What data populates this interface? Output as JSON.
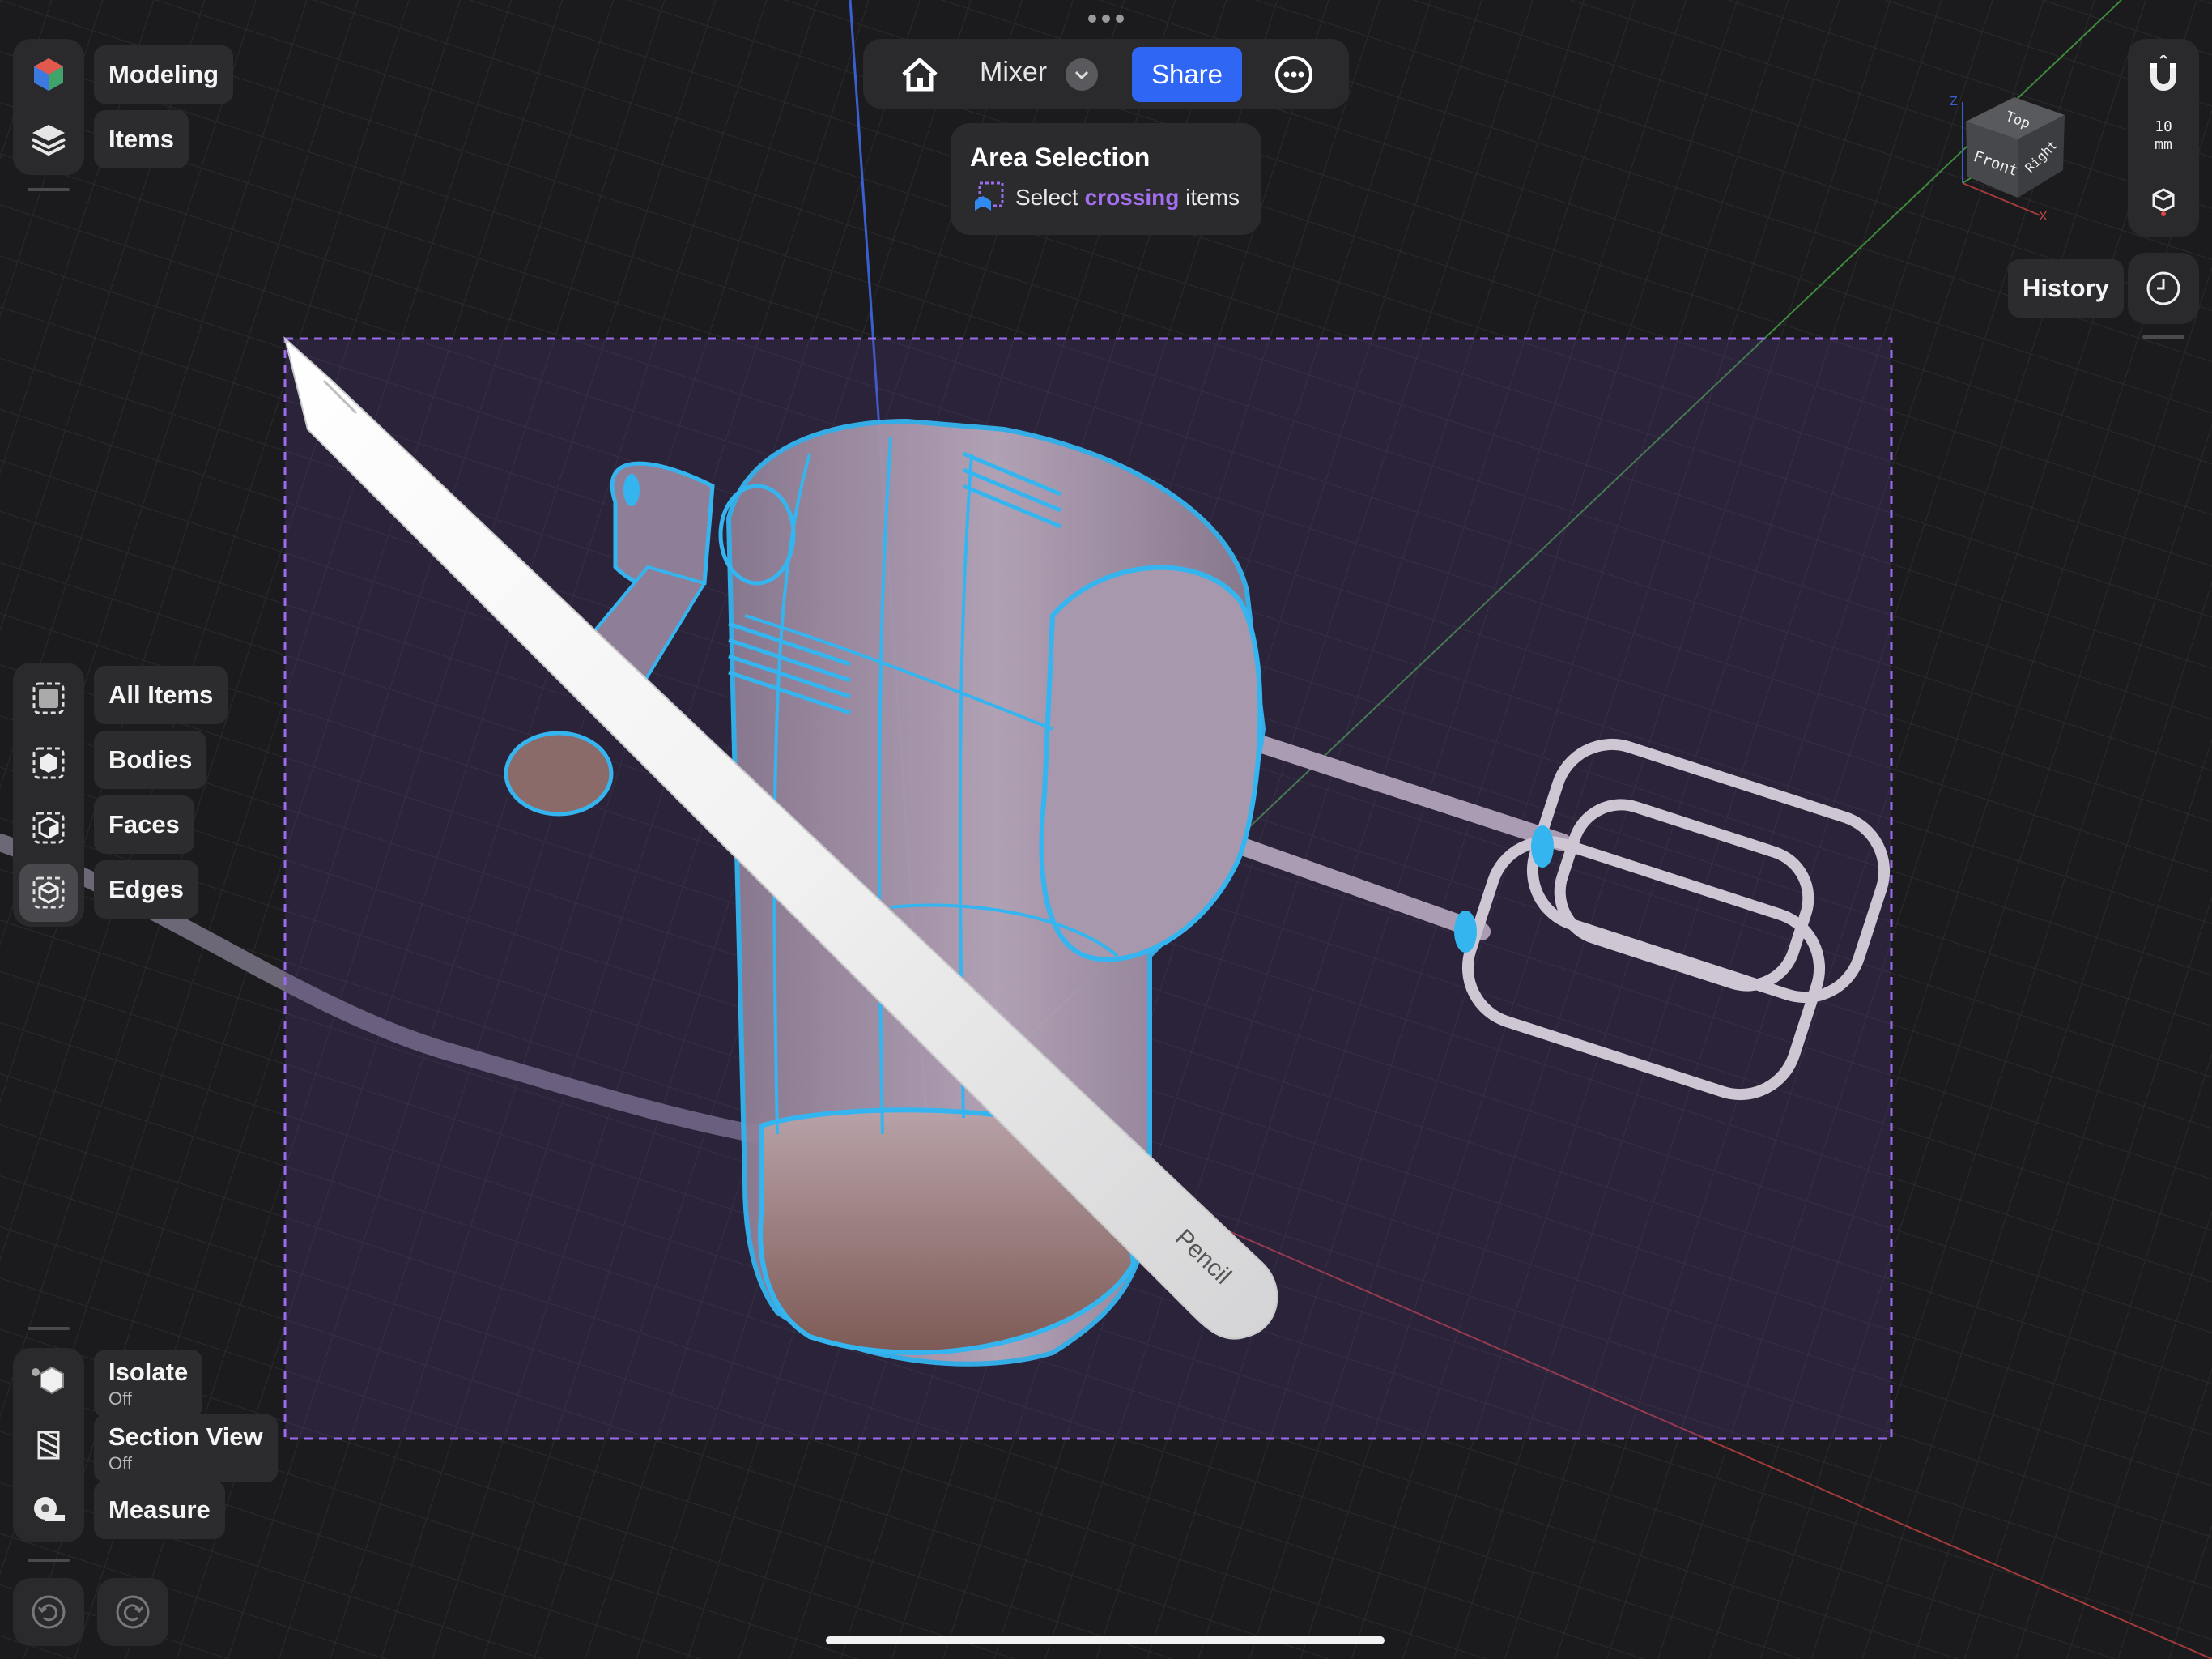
{
  "toolbar": {
    "document_name": "Mixer",
    "share_label": "Share"
  },
  "tooltip": {
    "title": "Area Selection",
    "prefix": "Select",
    "highlight": "crossing",
    "suffix": "items"
  },
  "left_panel": {
    "workspace_label": "Modeling",
    "items_label": "Items"
  },
  "selection_filter": {
    "items": [
      {
        "label": "All Items",
        "icon": "all-items-icon"
      },
      {
        "label": "Bodies",
        "icon": "bodies-icon"
      },
      {
        "label": "Faces",
        "icon": "faces-icon"
      },
      {
        "label": "Edges",
        "icon": "edges-icon",
        "active": true
      }
    ]
  },
  "tools": {
    "isolate_label": "Isolate",
    "isolate_state": "Off",
    "section_label": "Section View",
    "section_state": "Off",
    "measure_label": "Measure"
  },
  "right_panel": {
    "grid_value": "10",
    "grid_unit": "mm",
    "history_label": "History"
  },
  "view_cube": {
    "top": "Top",
    "front": "Front",
    "right": "Right",
    "axis_z": "Z",
    "axis_x": "X"
  },
  "model": {
    "engraving": "Pencil"
  },
  "colors": {
    "accent_blue": "#2f66f3",
    "selection_purple": "#9b6cf0",
    "edge_cyan": "#35b5f0"
  }
}
